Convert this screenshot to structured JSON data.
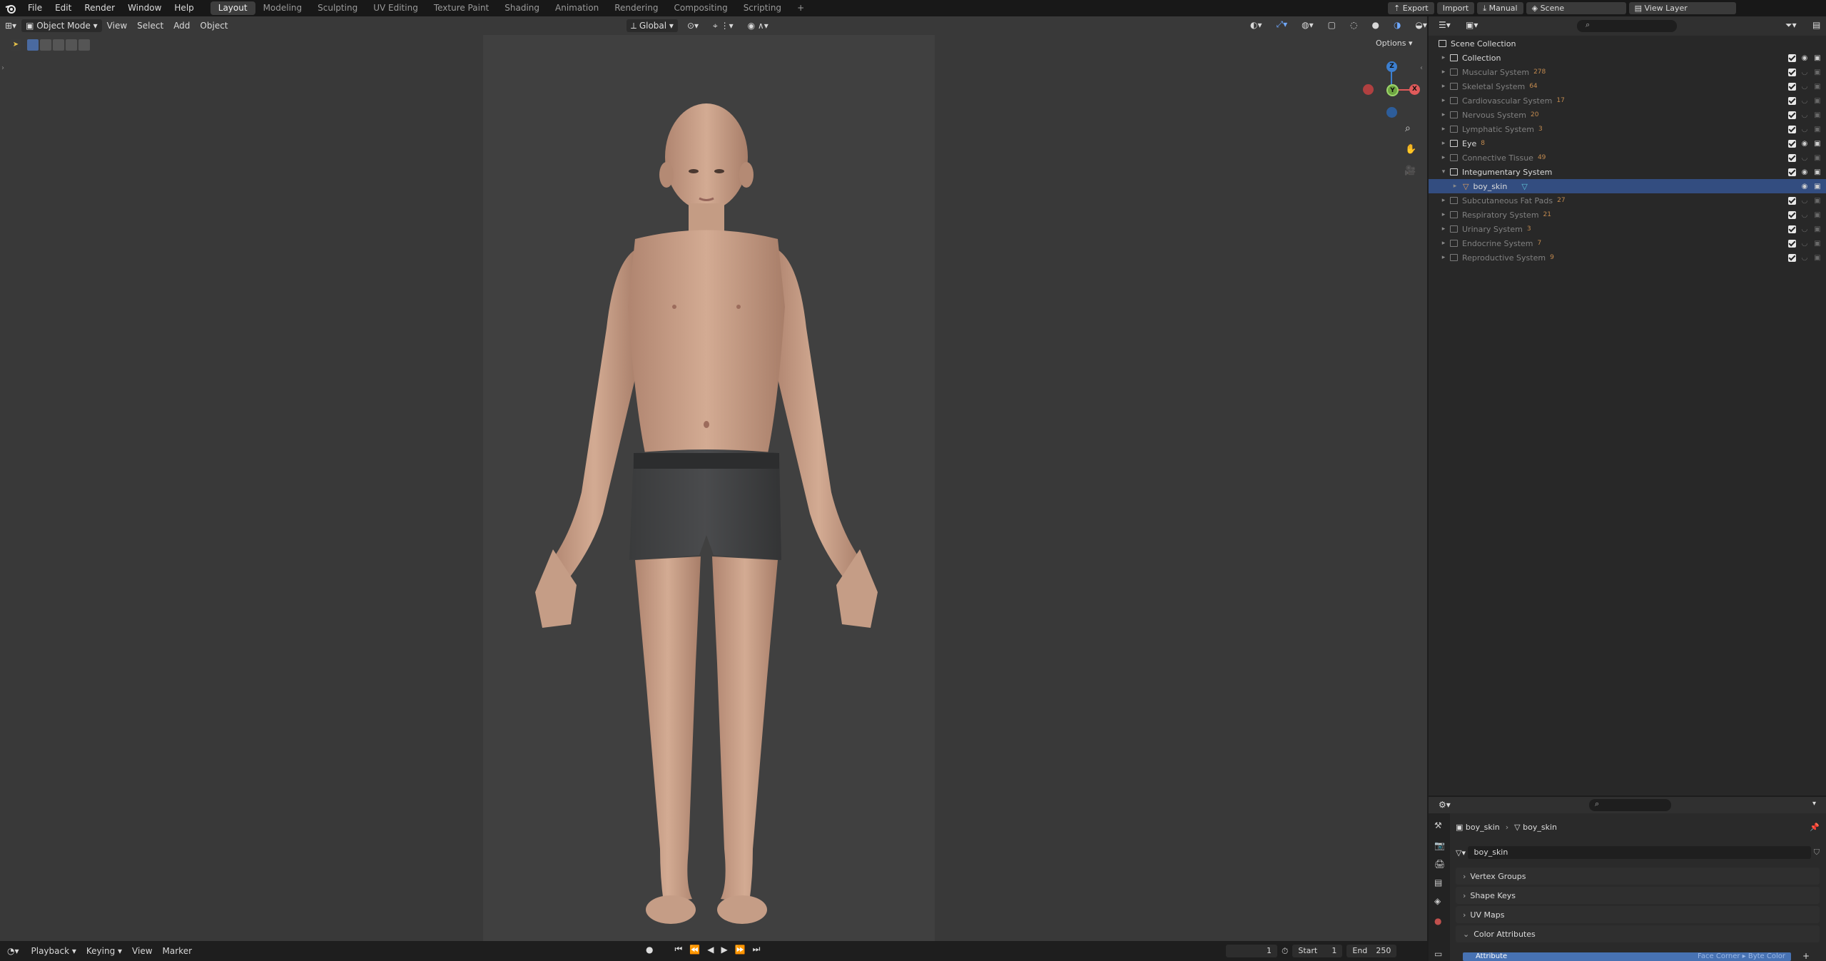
{
  "topbar": {
    "menus": [
      "File",
      "Edit",
      "Render",
      "Window",
      "Help"
    ],
    "workspaces": [
      "Layout",
      "Modeling",
      "Sculpting",
      "UV Editing",
      "Texture Paint",
      "Shading",
      "Animation",
      "Rendering",
      "Compositing",
      "Scripting"
    ],
    "active_workspace": "Layout",
    "add_tab": "+",
    "export_label": "Export",
    "import_label": "Import",
    "manual_label": "Manual",
    "scene_name": "Scene",
    "view_layer": "View Layer"
  },
  "viewport_header": {
    "mode": "Object Mode",
    "menus": [
      "View",
      "Select",
      "Add",
      "Object"
    ],
    "orientation": "Global",
    "options_label": "Options"
  },
  "gizmo": {
    "x": "X",
    "y": "Y",
    "z": "Z"
  },
  "outliner": {
    "root": "Scene Collection",
    "rows": [
      {
        "label": "Collection",
        "count": "",
        "enabled": true,
        "visible": true,
        "expanded": false
      },
      {
        "label": "Muscular System",
        "count": "278",
        "enabled": false,
        "visible": false,
        "expanded": false
      },
      {
        "label": "Skeletal System",
        "count": "64",
        "enabled": false,
        "visible": false,
        "expanded": false
      },
      {
        "label": "Cardiovascular System",
        "count": "17",
        "enabled": false,
        "visible": false,
        "expanded": false
      },
      {
        "label": "Nervous System",
        "count": "20",
        "enabled": false,
        "visible": false,
        "expanded": false
      },
      {
        "label": "Lymphatic System",
        "count": "3",
        "enabled": false,
        "visible": false,
        "expanded": false
      },
      {
        "label": "Eye",
        "count": "8",
        "enabled": true,
        "visible": true,
        "expanded": false
      },
      {
        "label": "Connective Tissue",
        "count": "49",
        "enabled": false,
        "visible": false,
        "expanded": false
      },
      {
        "label": "Integumentary System",
        "count": "",
        "enabled": true,
        "visible": true,
        "expanded": true
      },
      {
        "label": "boy_skin",
        "count": "",
        "enabled": true,
        "visible": true,
        "expanded": false,
        "selected": true,
        "child": true
      },
      {
        "label": "Subcutaneous Fat Pads",
        "count": "27",
        "enabled": false,
        "visible": false,
        "expanded": false
      },
      {
        "label": "Respiratory System",
        "count": "21",
        "enabled": false,
        "visible": false,
        "expanded": false
      },
      {
        "label": "Urinary System",
        "count": "3",
        "enabled": false,
        "visible": false,
        "expanded": false
      },
      {
        "label": "Endocrine System",
        "count": "7",
        "enabled": false,
        "visible": false,
        "expanded": false
      },
      {
        "label": "Reproductive System",
        "count": "9",
        "enabled": false,
        "visible": false,
        "expanded": false
      }
    ]
  },
  "properties": {
    "breadcrumb_object": "boy_skin",
    "breadcrumb_data": "boy_skin",
    "mesh_name": "boy_skin",
    "panels": [
      "Vertex Groups",
      "Shape Keys",
      "UV Maps",
      "Color Attributes"
    ],
    "attribute_label": "Attribute",
    "attribute_info": "Face Corner ▸ Byte Color"
  },
  "timeline": {
    "menus": [
      "Playback",
      "Keying",
      "View",
      "Marker"
    ],
    "current_frame": "1",
    "start_label": "Start",
    "start_value": "1",
    "end_label": "End",
    "end_value": "250"
  },
  "colors": {
    "accent_blue": "#334d80",
    "gizmo_x": "#e05a5a",
    "gizmo_y": "#6ea641",
    "gizmo_z": "#3c7fd0",
    "mesh_orange": "#c28a4f"
  }
}
